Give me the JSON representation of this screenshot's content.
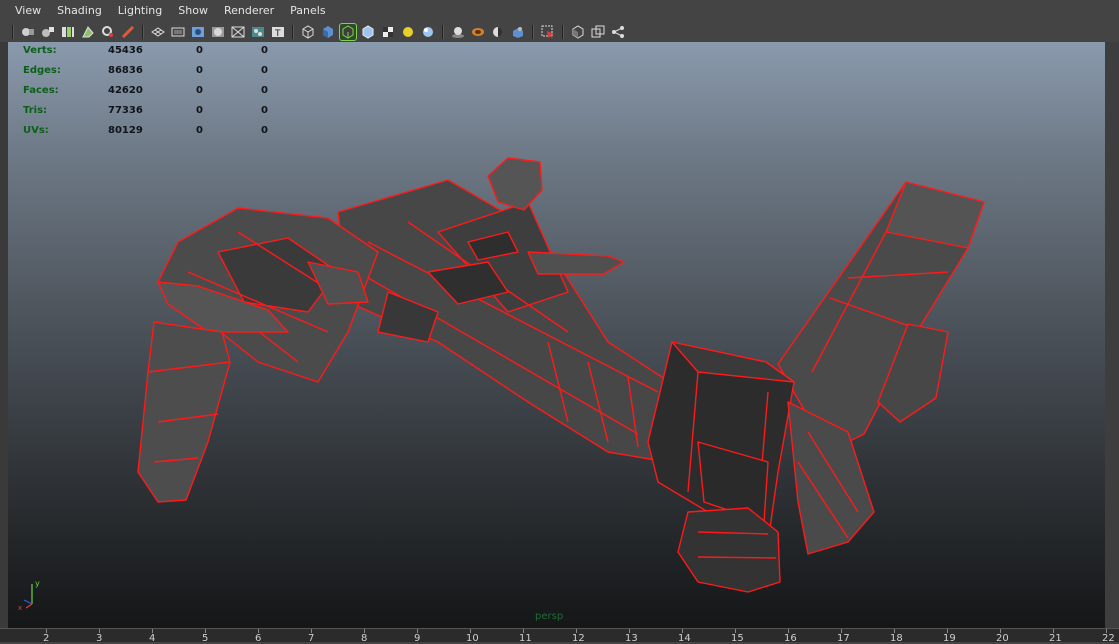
{
  "menubar": {
    "items": [
      "View",
      "Shading",
      "Lighting",
      "Show",
      "Renderer",
      "Panels"
    ]
  },
  "toolbar": {
    "groups": [
      [
        "camera-select-icon",
        "camera-attributes-icon",
        "bookmark-icon",
        "image-plane-icon",
        "2d-pan-zoom-icon",
        "grease-pencil-icon"
      ],
      [
        "grid-icon",
        "film-gate-icon",
        "resolution-gate-icon",
        "gate-mask-icon",
        "field-chart-icon",
        "safe-action-icon",
        "safe-title-icon"
      ],
      [
        "wireframe-icon",
        "smooth-shade-icon",
        "wireframe-on-shaded-icon",
        "xray-icon",
        "textured-icon",
        "use-lights-icon",
        "shadows-icon",
        "screen-space-ao-icon",
        "motion-blur-icon",
        "multisample-aa-icon"
      ],
      [
        "isolate-select-icon"
      ],
      [
        "xray-joints-icon",
        "xray-active-components-icon",
        "node-editor-icon"
      ]
    ],
    "active_icon": "wireframe-on-shaded-icon"
  },
  "hud": {
    "rows": [
      {
        "label": "Verts:",
        "v1": "45436",
        "v2": "0",
        "v3": "0"
      },
      {
        "label": "Edges:",
        "v1": "86836",
        "v2": "0",
        "v3": "0"
      },
      {
        "label": "Faces:",
        "v1": "42620",
        "v2": "0",
        "v3": "0"
      },
      {
        "label": "Tris:",
        "v1": "77336",
        "v2": "0",
        "v3": "0"
      },
      {
        "label": "UVs:",
        "v1": "80129",
        "v2": "0",
        "v3": "0"
      }
    ]
  },
  "viewport": {
    "camera_label": "persp",
    "axis_y": "y",
    "axis_x": "x",
    "wire_color": "#ff1a1a"
  },
  "timeline": {
    "ticks": [
      "2",
      "3",
      "4",
      "5",
      "6",
      "7",
      "8",
      "9",
      "10",
      "11",
      "12",
      "13",
      "14",
      "15",
      "16",
      "17",
      "18",
      "19",
      "20",
      "21",
      "22"
    ]
  }
}
